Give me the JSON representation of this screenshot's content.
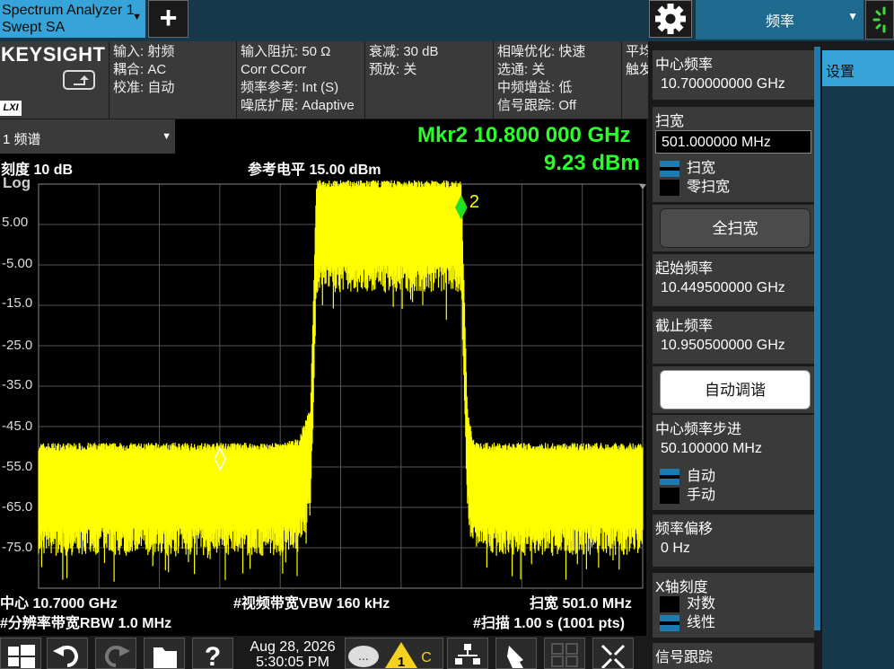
{
  "app": {
    "tab_line1": "Spectrum Analyzer 1",
    "tab_line2": "Swept SA",
    "add_label": "+",
    "menu_select": "频率",
    "settings_tab": "设置"
  },
  "brand": {
    "name": "KEYSIGHT",
    "lxi": "LXI"
  },
  "info": {
    "col1": [
      "输入: 射频",
      "耦合: AC",
      "校准: 自动"
    ],
    "col2": [
      "输入阻抗: 50 Ω",
      "Corr CCorr",
      "频率参考: Int (S)",
      "噪底扩展: Adaptive"
    ],
    "col3": [
      "衰减: 30 dB",
      "预放: 关"
    ],
    "col4": [
      "相噪优化: 快速",
      "选通: 关",
      "中频增益: 低",
      "信号跟踪: Off"
    ],
    "col5": [
      "平均",
      "触发"
    ]
  },
  "trace": {
    "selector": "1 频谱"
  },
  "marker": {
    "label": "Mkr2  10.800 000 GHz",
    "value": "9.23 dBm",
    "m1": "1",
    "m2": "2"
  },
  "screen": {
    "scale": "刻度 10 dB",
    "log": "Log",
    "ref_level": "参考电平 15.00 dBm",
    "center": "中心 10.7000 GHz",
    "vbw": "#视频带宽VBW 160 kHz",
    "span": "扫宽 501.0 MHz",
    "rbw": "#分辨率带宽RBW 1.0 MHz",
    "sweep": "#扫描 1.00 s (1001 pts)",
    "yticks": [
      "5.00",
      "-5.00",
      "-15.0",
      "-25.0",
      "-35.0",
      "-45.0",
      "-55.0",
      "-65.0",
      "-75.0"
    ]
  },
  "chart_data": {
    "type": "line",
    "title": "",
    "xlabel": "",
    "ylabel": "",
    "x_range_ghz": [
      10.4495,
      10.9505
    ],
    "ylim": [
      -85,
      15
    ],
    "series": [
      {
        "x": [
          10.4495,
          10.6,
          10.65,
          10.665,
          10.675,
          10.68,
          10.8,
          10.805,
          10.81,
          10.82,
          10.9505
        ],
        "values": [
          -56,
          -56,
          -56,
          -55,
          -47,
          9,
          9,
          -47,
          -55,
          -56,
          -56
        ]
      }
    ],
    "markers": [
      {
        "id": "1",
        "x": 10.6,
        "y": -53
      },
      {
        "id": "2",
        "x": 10.8,
        "y": 9.23
      }
    ]
  },
  "panel": {
    "center_freq_label": "中心频率",
    "center_freq_value": "10.700000000 GHz",
    "span_label": "扫宽",
    "span_value": "501.000000 MHz",
    "span_opt1": "扫宽",
    "span_opt2": "零扫宽",
    "full_span": "全扫宽",
    "start_label": "起始频率",
    "start_value": "10.449500000 GHz",
    "stop_label": "截止频率",
    "stop_value": "10.950500000 GHz",
    "auto_tune": "自动调谐",
    "step_label": "中心频率步进",
    "step_value": "50.100000 MHz",
    "step_opt1": "自动",
    "step_opt2": "手动",
    "offset_label": "频率偏移",
    "offset_value": "0 Hz",
    "xscale_label": "X轴刻度",
    "xscale_opt1": "对数",
    "xscale_opt2": "线性",
    "track_label": "信号跟踪"
  },
  "taskbar": {
    "date": "Aug 28, 2026",
    "time": "5:30:05 PM",
    "warn_count": "1",
    "warn_letter": "C"
  }
}
